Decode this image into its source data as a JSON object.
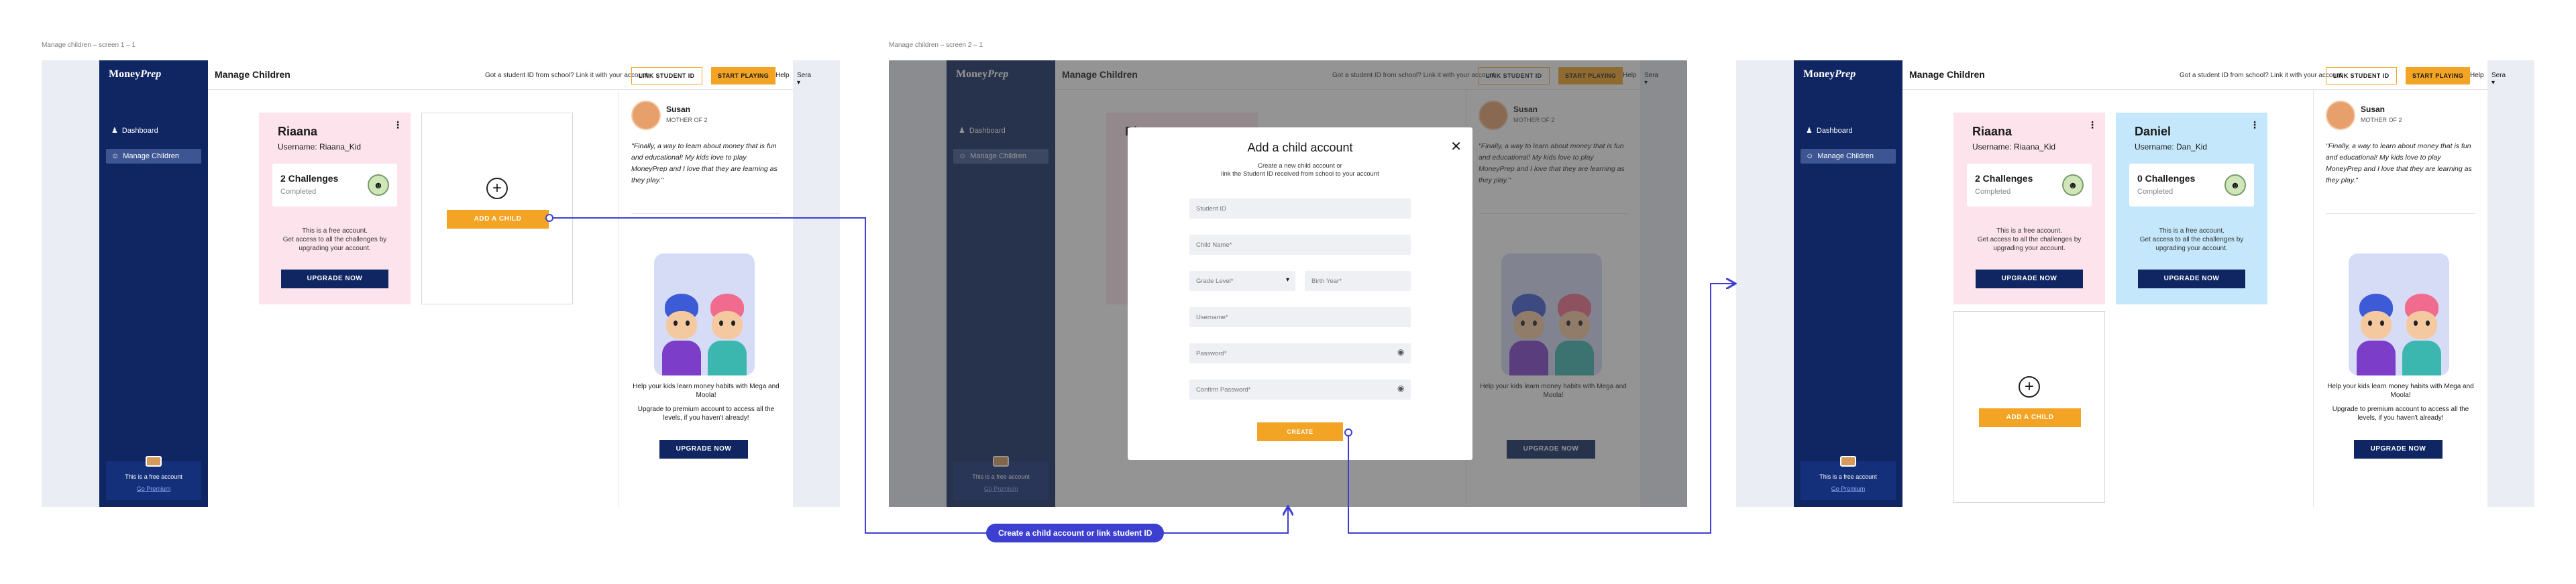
{
  "screens": [
    {
      "label": "Manage children – screen 1 – 1"
    },
    {
      "label": "Manage children – screen 2 – 1"
    }
  ],
  "app": {
    "logo_a": "Money",
    "logo_b": "Prep",
    "nav": [
      {
        "label": "Dashboard",
        "icon": "group-icon"
      },
      {
        "label": "Manage Children",
        "icon": "face-icon"
      }
    ],
    "page_title": "Manage Children",
    "got_text": "Got a student ID from school? Link it with your account",
    "link_label": "LINK STUDENT ID",
    "start_label": "START PLAYING",
    "help_label": "Help",
    "user_label": "Sera",
    "free_text": "This is a free account",
    "go_premium": "Go Premium"
  },
  "children": [
    {
      "name": "Riaana",
      "username": "Username: Riaana_Kid",
      "challenges": "2 Challenges",
      "completed": "Completed",
      "free_note": "This is a free account.",
      "access_note": "Get access to all the challenges by",
      "upgrade_note": "upgrading your account.",
      "upgrade": "UPGRADE NOW"
    },
    {
      "name": "Daniel",
      "username": "Username: Dan_Kid",
      "challenges": "0 Challenges",
      "completed": "Completed",
      "free_note": "This is a free account.",
      "access_note": "Get access to all the challenges by",
      "upgrade_note": "upgrading your account.",
      "upgrade": "UPGRADE NOW"
    }
  ],
  "add_child": "ADD A CHILD",
  "testimonial": {
    "name": "Susan",
    "role": "MOTHER OF 2",
    "quote": "\"Finally, a way to learn about money that is fun and educational! My kids love to play MoneyPrep and I love that they are learning as they play.\""
  },
  "promo": {
    "line1": "Help your kids learn money habits with Mega and Moola!",
    "line2": "Upgrade to premium account to access all the levels, if you haven't already!",
    "upgrade": "UPGRADE NOW"
  },
  "modal": {
    "title": "Add a child account",
    "sub1": "Create a new child account or",
    "sub2": "link the Student ID received from school to your account",
    "student_id": "Student ID",
    "child_name": "Child Name*",
    "grade_level": "Grade Level*",
    "birth_year": "Birth Year*",
    "username": "Username*",
    "password": "Password*",
    "confirm_password": "Confirm Password*",
    "create": "CREATE"
  },
  "flow": {
    "label": "Create a child account or link student ID",
    "color": "#3d3fd0"
  },
  "colors": {
    "navy": "#0f2663",
    "accent": "#f4a424",
    "pink": "#fde4ec",
    "blue": "#c5e7fb"
  }
}
